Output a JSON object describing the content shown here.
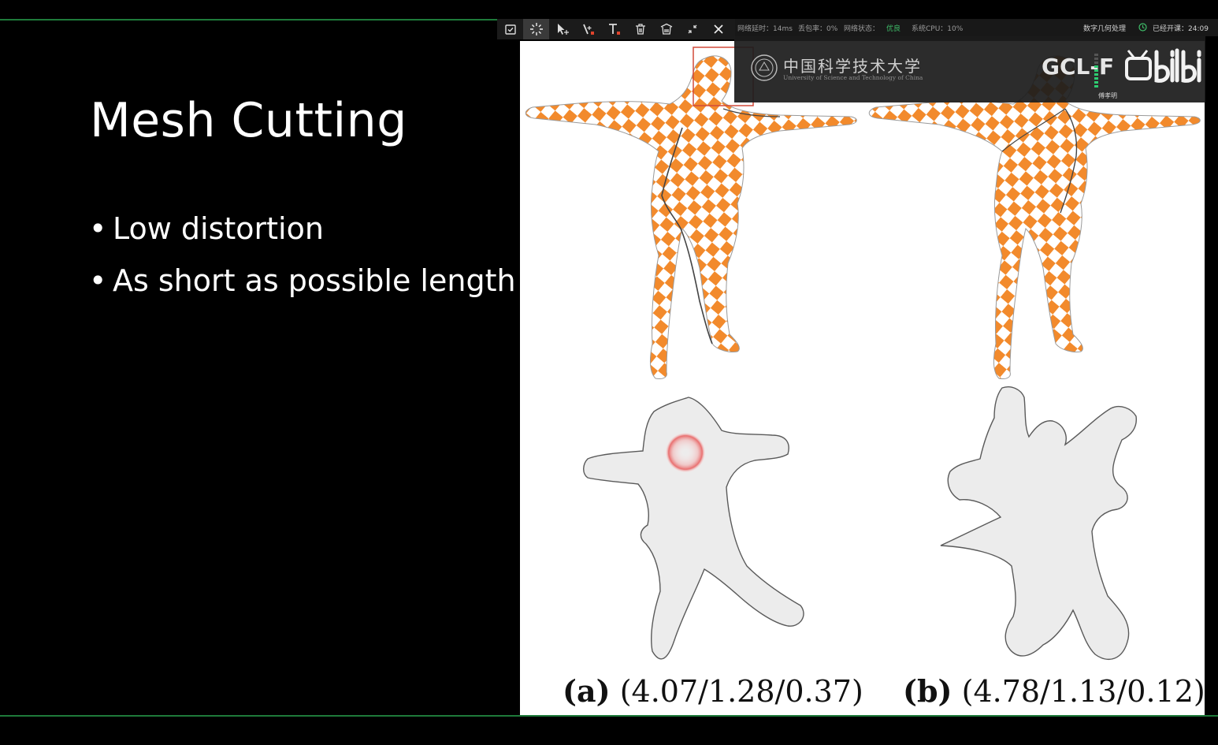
{
  "slide": {
    "title": "Mesh Cutting",
    "bullets": [
      {
        "marker": "•",
        "text": "Low distortion"
      },
      {
        "marker": "•",
        "text": "As short as possible length"
      }
    ],
    "figure": {
      "captions": [
        {
          "label": "(a)",
          "values": "(4.07/1.28/0.37)"
        },
        {
          "label": "(b)",
          "values": "(4.78/1.13/0.12)"
        }
      ],
      "colors": {
        "checker": "#f28a2c",
        "checker_alt": "#ffffff",
        "param": "#ececec",
        "cut": "#444444",
        "hotspot": "#e85050"
      }
    }
  },
  "annotation_toolbar": {
    "tools": [
      {
        "name": "snapshot-icon"
      },
      {
        "name": "laser-pointer-icon",
        "active": true
      },
      {
        "name": "move-select-icon"
      },
      {
        "name": "pen-icon"
      },
      {
        "name": "text-icon"
      },
      {
        "name": "trash-icon"
      },
      {
        "name": "clear-all-icon"
      },
      {
        "name": "collapse-icon"
      },
      {
        "name": "close-icon"
      }
    ],
    "accent": "#e0442c"
  },
  "status_bar": {
    "latency": "网络延时：14ms",
    "packet_loss": "丢包率：0%",
    "network_label": "网络状态：",
    "network_value": "优良",
    "cpu": "系统CPU：10%",
    "course": "数字几何处理",
    "elapsed": "已经开课：24:09",
    "good_color": "#3fbf6a"
  },
  "overlay": {
    "university_cn": "中国科学技术大学",
    "university_en": "University of Science and Technology of China",
    "lab": "GCL-F",
    "presenter": "傅孝明",
    "platform": "bilibili",
    "meter_color": "#2ecc71"
  }
}
